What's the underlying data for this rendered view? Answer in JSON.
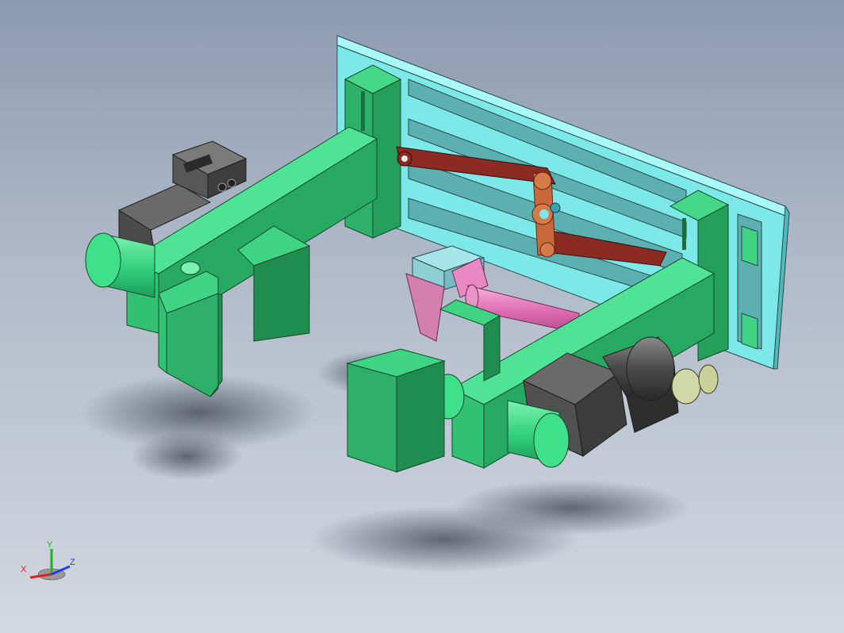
{
  "viewport": {
    "background_top": "#8c9ab0",
    "background_bottom": "#d3d8e1"
  },
  "model_colors": {
    "frame_plate": "#7de8e8",
    "crane_beam": "#36c47a",
    "gripper_block": "#2fb06a",
    "lever_arm": "#8b2a23",
    "linkage_plate": "#c9683d",
    "shaft": "#e16fb4",
    "motor_housing": "#555555",
    "shaft_end": "#3fe08a"
  },
  "motor_badge_text": "",
  "triad": {
    "x_label": "X",
    "y_label": "Y",
    "z_label": "Z",
    "x_color": "#e02020",
    "y_color": "#20b020",
    "z_color": "#2040e0"
  }
}
